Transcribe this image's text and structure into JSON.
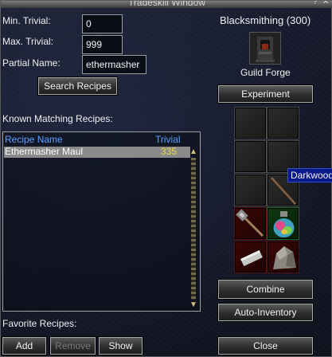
{
  "window": {
    "title": "Tradeskill Window"
  },
  "filters": {
    "min_trivial_label": "Min. Trivial:",
    "min_trivial_value": "0",
    "max_trivial_label": "Max. Trivial:",
    "max_trivial_value": "999",
    "partial_name_label": "Partial Name:",
    "partial_name_value": "ethermasher",
    "search_button": "Search Recipes"
  },
  "skill": {
    "name": "Blacksmithing (300)",
    "container_name": "Guild Forge",
    "experiment_button": "Experiment"
  },
  "recipes": {
    "header": "Known Matching Recipes:",
    "columns": [
      "Recipe Name",
      "Trivial"
    ],
    "rows": [
      {
        "name": "Ethermasher Maul",
        "trivial": "335",
        "selected": true
      }
    ]
  },
  "favorites": {
    "label": "Favorite Recipes:",
    "add_button": "Add",
    "remove_button": "Remove",
    "show_button": "Show"
  },
  "combine": {
    "combine_button": "Combine",
    "auto_inventory_button": "Auto-Inventory",
    "close_button": "Close",
    "tooltip": "Darkwood"
  },
  "colors": {
    "column_header": "#5aa0ff",
    "trivial_value": "#e8d84a",
    "selection": "#8a8a8a",
    "tooltip_bg": "#0a1a8a"
  },
  "icons": {
    "slot_6": "wooden-staff-icon",
    "slot_7": "maul-icon",
    "slot_8": "potion-flask-icon",
    "slot_9": "metal-bar-icon",
    "slot_10": "ore-rock-icon"
  }
}
